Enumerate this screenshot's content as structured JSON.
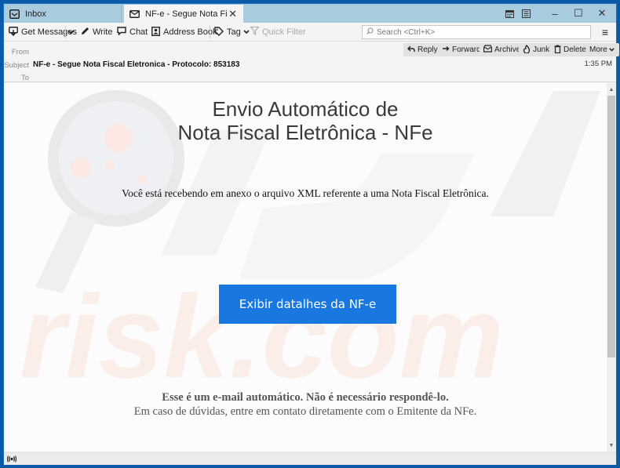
{
  "tabs": [
    {
      "label": "Inbox",
      "icon": "inbox-icon",
      "active": false
    },
    {
      "label": "NF-e - Segue Nota Fiscal Ele",
      "icon": "envelope-icon",
      "active": true
    }
  ],
  "window_controls": {
    "calendar": "calendar-icon",
    "tasks": "tasks-icon",
    "minimize": "–",
    "maximize": "☐",
    "close": "✕"
  },
  "toolbar": {
    "get_messages": "Get Messages",
    "write": "Write",
    "chat": "Chat",
    "address_book": "Address Book",
    "tag": "Tag",
    "quick_filter": "Quick Filter",
    "search_placeholder": "Search <Ctrl+K>",
    "menu": "≡"
  },
  "header": {
    "from_label": "From",
    "from_value": "",
    "subject_label": "Subject",
    "subject_value": "NF-e - Segue Nota Fiscal Eletronica - Protocolo: 853183",
    "to_label": "To",
    "to_value": "",
    "time": "1:35 PM",
    "actions": {
      "reply": "Reply",
      "forward": "Forward",
      "archive": "Archive",
      "junk": "Junk",
      "delete": "Delete",
      "more": "More"
    }
  },
  "email": {
    "heading_line1": "Envio Automático de",
    "heading_line2": "Nota Fiscal Eletrônica - NFe",
    "intro": "Você está recebendo em anexo o arquivo XML referente a uma Nota Fiscal Eletrônica.",
    "cta_label": "Exibir datalhes da NF-e",
    "footer_bold": "Esse é um e-mail automático. Não é necessário respondê-lo.",
    "footer_regular": "Em caso de dúvidas, entre em contato diretamente com o Emitente da NFe.",
    "cta_color": "#1878e0"
  },
  "watermark": {
    "text": "risk.com"
  },
  "statusbar": {
    "icon": "online-status-icon"
  }
}
